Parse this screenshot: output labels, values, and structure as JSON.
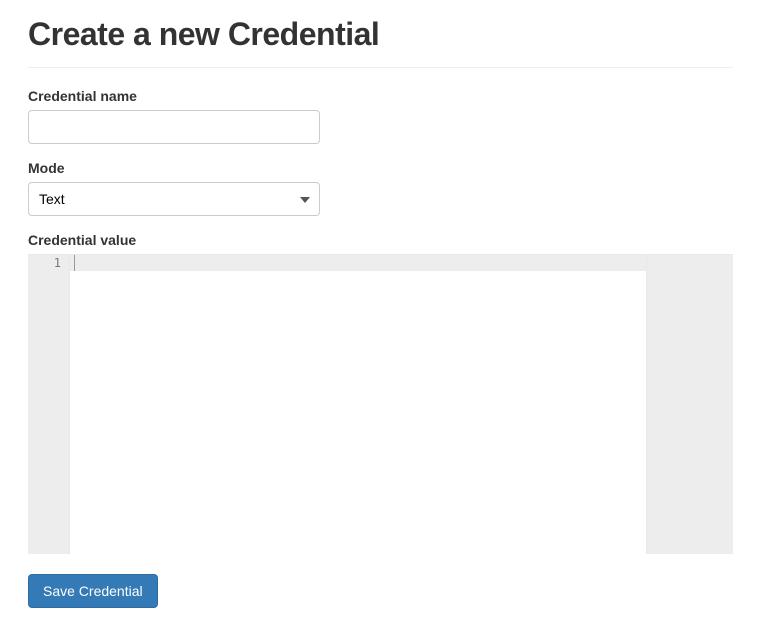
{
  "page": {
    "title": "Create a new Credential"
  },
  "form": {
    "name_label": "Credential name",
    "name_value": "",
    "mode_label": "Mode",
    "mode_selected": "Text",
    "mode_options": [
      "Text"
    ],
    "value_label": "Credential value",
    "line_number": "1",
    "code_value": ""
  },
  "actions": {
    "save_label": "Save Credential"
  }
}
